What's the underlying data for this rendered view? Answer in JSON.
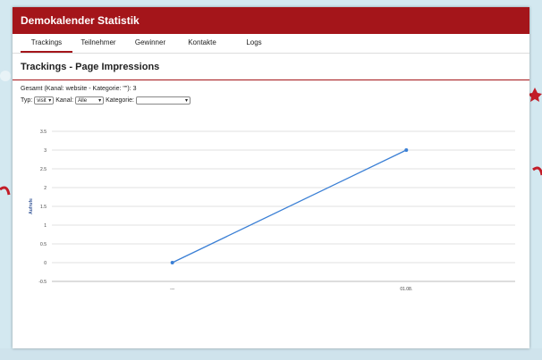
{
  "app": {
    "title": "Demokalender Statistik"
  },
  "tabs": [
    {
      "label": "Trackings"
    },
    {
      "label": "Teilnehmer"
    },
    {
      "label": "Gewinner"
    },
    {
      "label": "Kontakte"
    },
    {
      "label": "Logs"
    }
  ],
  "page": {
    "title": "Trackings - Page Impressions",
    "summary": "Gesamt (Kanal: website - Kategorie: \"\"): 3"
  },
  "filters": {
    "typ_label": "Typ:",
    "typ_value": "visit",
    "kanal_label": "Kanal:",
    "kanal_value": "Alle",
    "kategorie_label": "Kategorie:",
    "kategorie_value": ""
  },
  "colors": {
    "accent": "#a4151a",
    "line": "#3a7fd5"
  },
  "chart_data": {
    "type": "line",
    "categories": [
      "---",
      "01.08."
    ],
    "series": [
      {
        "values": [
          0,
          3
        ]
      }
    ],
    "ylabel": "Aufrufe",
    "xlabel": "",
    "ylim": [
      -0.5,
      3.5
    ],
    "yticks": [
      "3.5",
      "3",
      "2.5",
      "2",
      "1.5",
      "1",
      "0.5",
      "0",
      "-0.5"
    ],
    "grid": true
  }
}
